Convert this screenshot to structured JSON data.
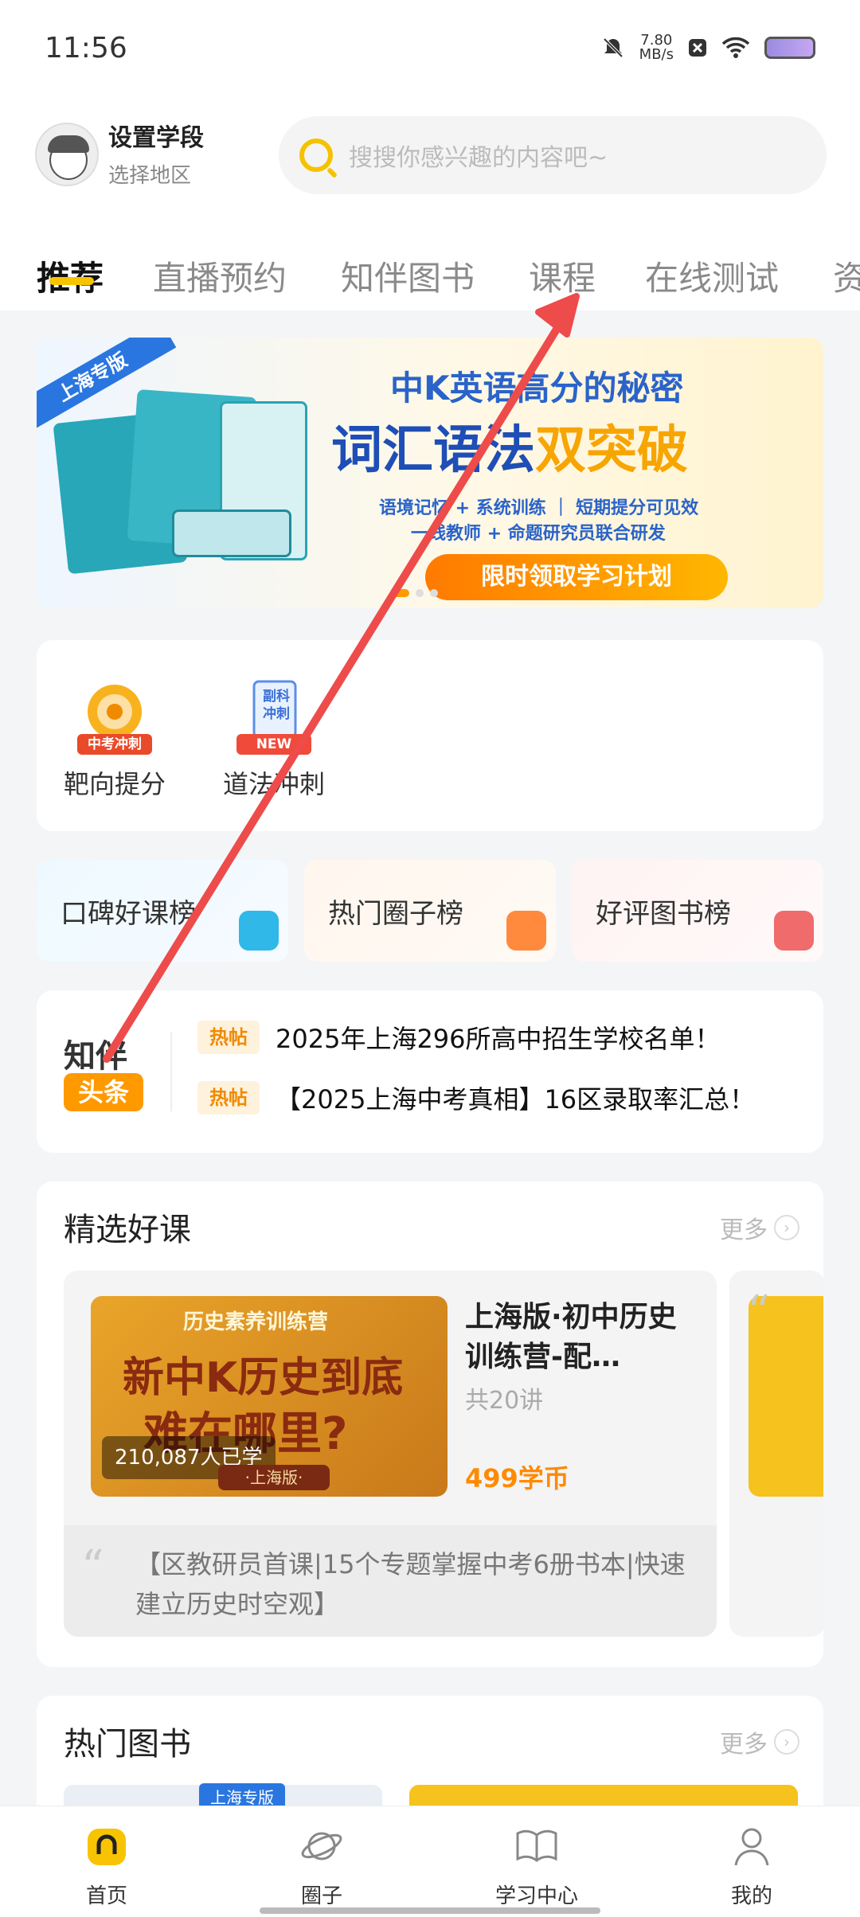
{
  "status_bar": {
    "time": "11:56",
    "speed": "7.80",
    "speed_unit": "MB/s"
  },
  "header": {
    "grade": "设置学段",
    "region": "选择地区",
    "search_placeholder": "搜搜你感兴趣的内容吧~"
  },
  "tabs": [
    "推荐",
    "直播预约",
    "知伴图书",
    "课程",
    "在线测试",
    "资"
  ],
  "banner": {
    "ribbon": "上海专版",
    "title1": "中K英语高分的秘密",
    "title2a": "词汇语法",
    "title2b": "双突破",
    "line1": "语境记忆 + 系统训练 ｜ 短期提分可见效",
    "line2": "一线教师 + 命题研究员联合研发",
    "cta": "限时领取学习计划"
  },
  "shortcuts": [
    {
      "label": "靶向提分",
      "badge": "中考冲刺",
      "icon": "target-icon"
    },
    {
      "label": "道法冲刺",
      "badge": "NEW",
      "tag1": "副科",
      "tag2": "冲刺",
      "icon": "book-new-icon"
    }
  ],
  "ranks": [
    {
      "label": "口碑好课榜",
      "icon": "video-icon",
      "color": "#2fb8e8"
    },
    {
      "label": "热门圈子榜",
      "icon": "group-icon",
      "color": "#ff8a3d"
    },
    {
      "label": "好评图书榜",
      "icon": "book-icon",
      "color": "#f06b6b"
    }
  ],
  "headline": {
    "brand": "知伴",
    "tag": "头条",
    "items": [
      {
        "badge": "热帖",
        "text": "2025年上海296所高中招生学校名单！"
      },
      {
        "badge": "热帖",
        "text": "【2025上海中考真相】16区录取率汇总！"
      }
    ]
  },
  "featured": {
    "title": "精选好课",
    "more": "更多",
    "course": {
      "cover_top": "历史素养训练营",
      "cover_line1": "新中K历史到底",
      "cover_line2": "难在哪里?",
      "learners": "210,087人已学",
      "edition": "·上海版·",
      "title": "上海版·初中历史训练营-配…",
      "lessons": "共20讲",
      "price": "499学币",
      "quote": "【区教研员首课|15个专题掌握中考6册书本|快速建立历史时空观】"
    }
  },
  "books": {
    "title": "热门图书",
    "more": "更多",
    "tag": "上海专版"
  },
  "nav": [
    {
      "label": "首页",
      "icon": "home-icon"
    },
    {
      "label": "圈子",
      "icon": "planet-icon"
    },
    {
      "label": "学习中心",
      "icon": "open-book-icon"
    },
    {
      "label": "我的",
      "icon": "person-icon"
    }
  ],
  "colors": {
    "accent": "#f8c300",
    "price": "#ff8a00",
    "annotation_arrow": "#ee4b4b"
  }
}
